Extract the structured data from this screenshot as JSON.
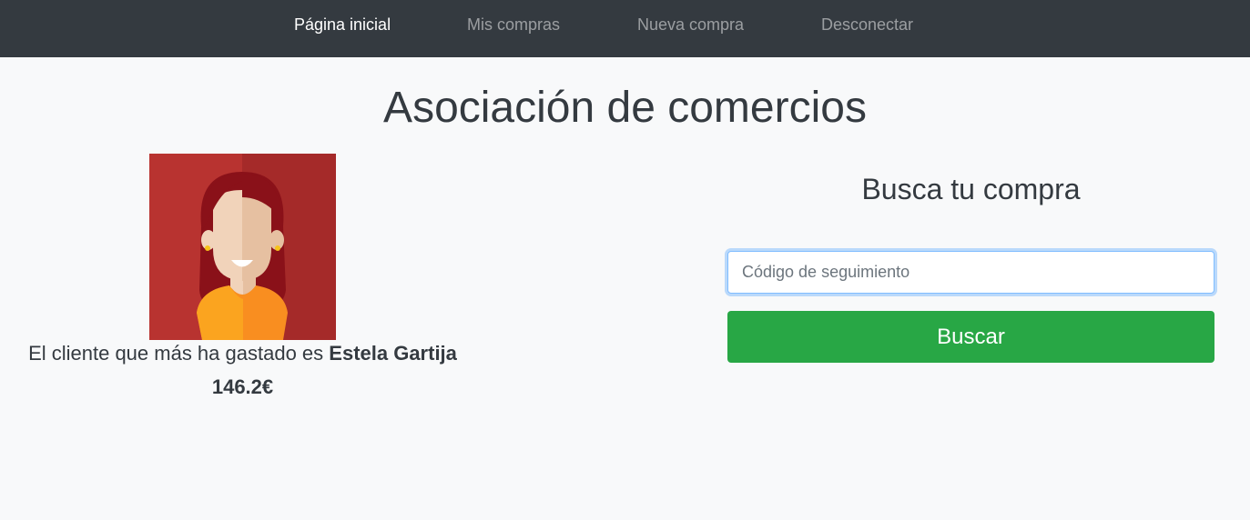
{
  "nav": {
    "items": [
      {
        "label": "Página inicial",
        "active": true
      },
      {
        "label": "Mis compras",
        "active": false
      },
      {
        "label": "Nueva compra",
        "active": false
      },
      {
        "label": "Desconectar",
        "active": false
      }
    ]
  },
  "page": {
    "title": "Asociación de comercios"
  },
  "top_customer": {
    "text_prefix": "El cliente que más ha gastado es",
    "name": "Estela Gartija",
    "amount": "146.2€",
    "avatar_icon": "woman-avatar-icon"
  },
  "search": {
    "title": "Busca tu compra",
    "input_placeholder": "Código de seguimiento",
    "input_value": "",
    "button_label": "Buscar"
  },
  "colors": {
    "navbar_bg": "#343a40",
    "page_bg": "#f8f9fa",
    "button_bg": "#28a745",
    "avatar_bg_left": "#b83330",
    "avatar_bg_right": "#a52a29"
  }
}
